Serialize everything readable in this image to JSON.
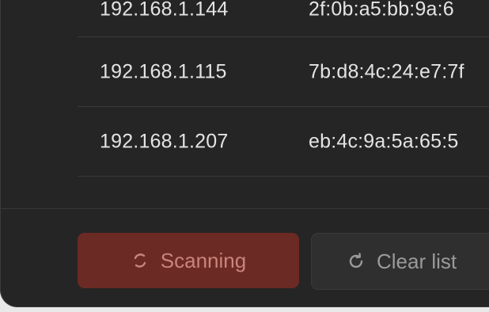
{
  "devices": [
    {
      "ip": "192.168.1.144",
      "mac": "2f:0b:a5:bb:9a:6"
    },
    {
      "ip": "192.168.1.115",
      "mac": "7b:d8:4c:24:e7:7f"
    },
    {
      "ip": "192.168.1.207",
      "mac": "eb:4c:9a:5a:65:5"
    }
  ],
  "actions": {
    "scan_label": "Scanning",
    "scan_icon": "spinner-icon",
    "clear_label": "Clear list",
    "clear_icon": "refresh-icon"
  },
  "colors": {
    "scan_bg": "#6b2a24",
    "scan_text": "#c9847c",
    "clear_bg": "#2f2f2f",
    "clear_text": "#9a9a9a"
  }
}
